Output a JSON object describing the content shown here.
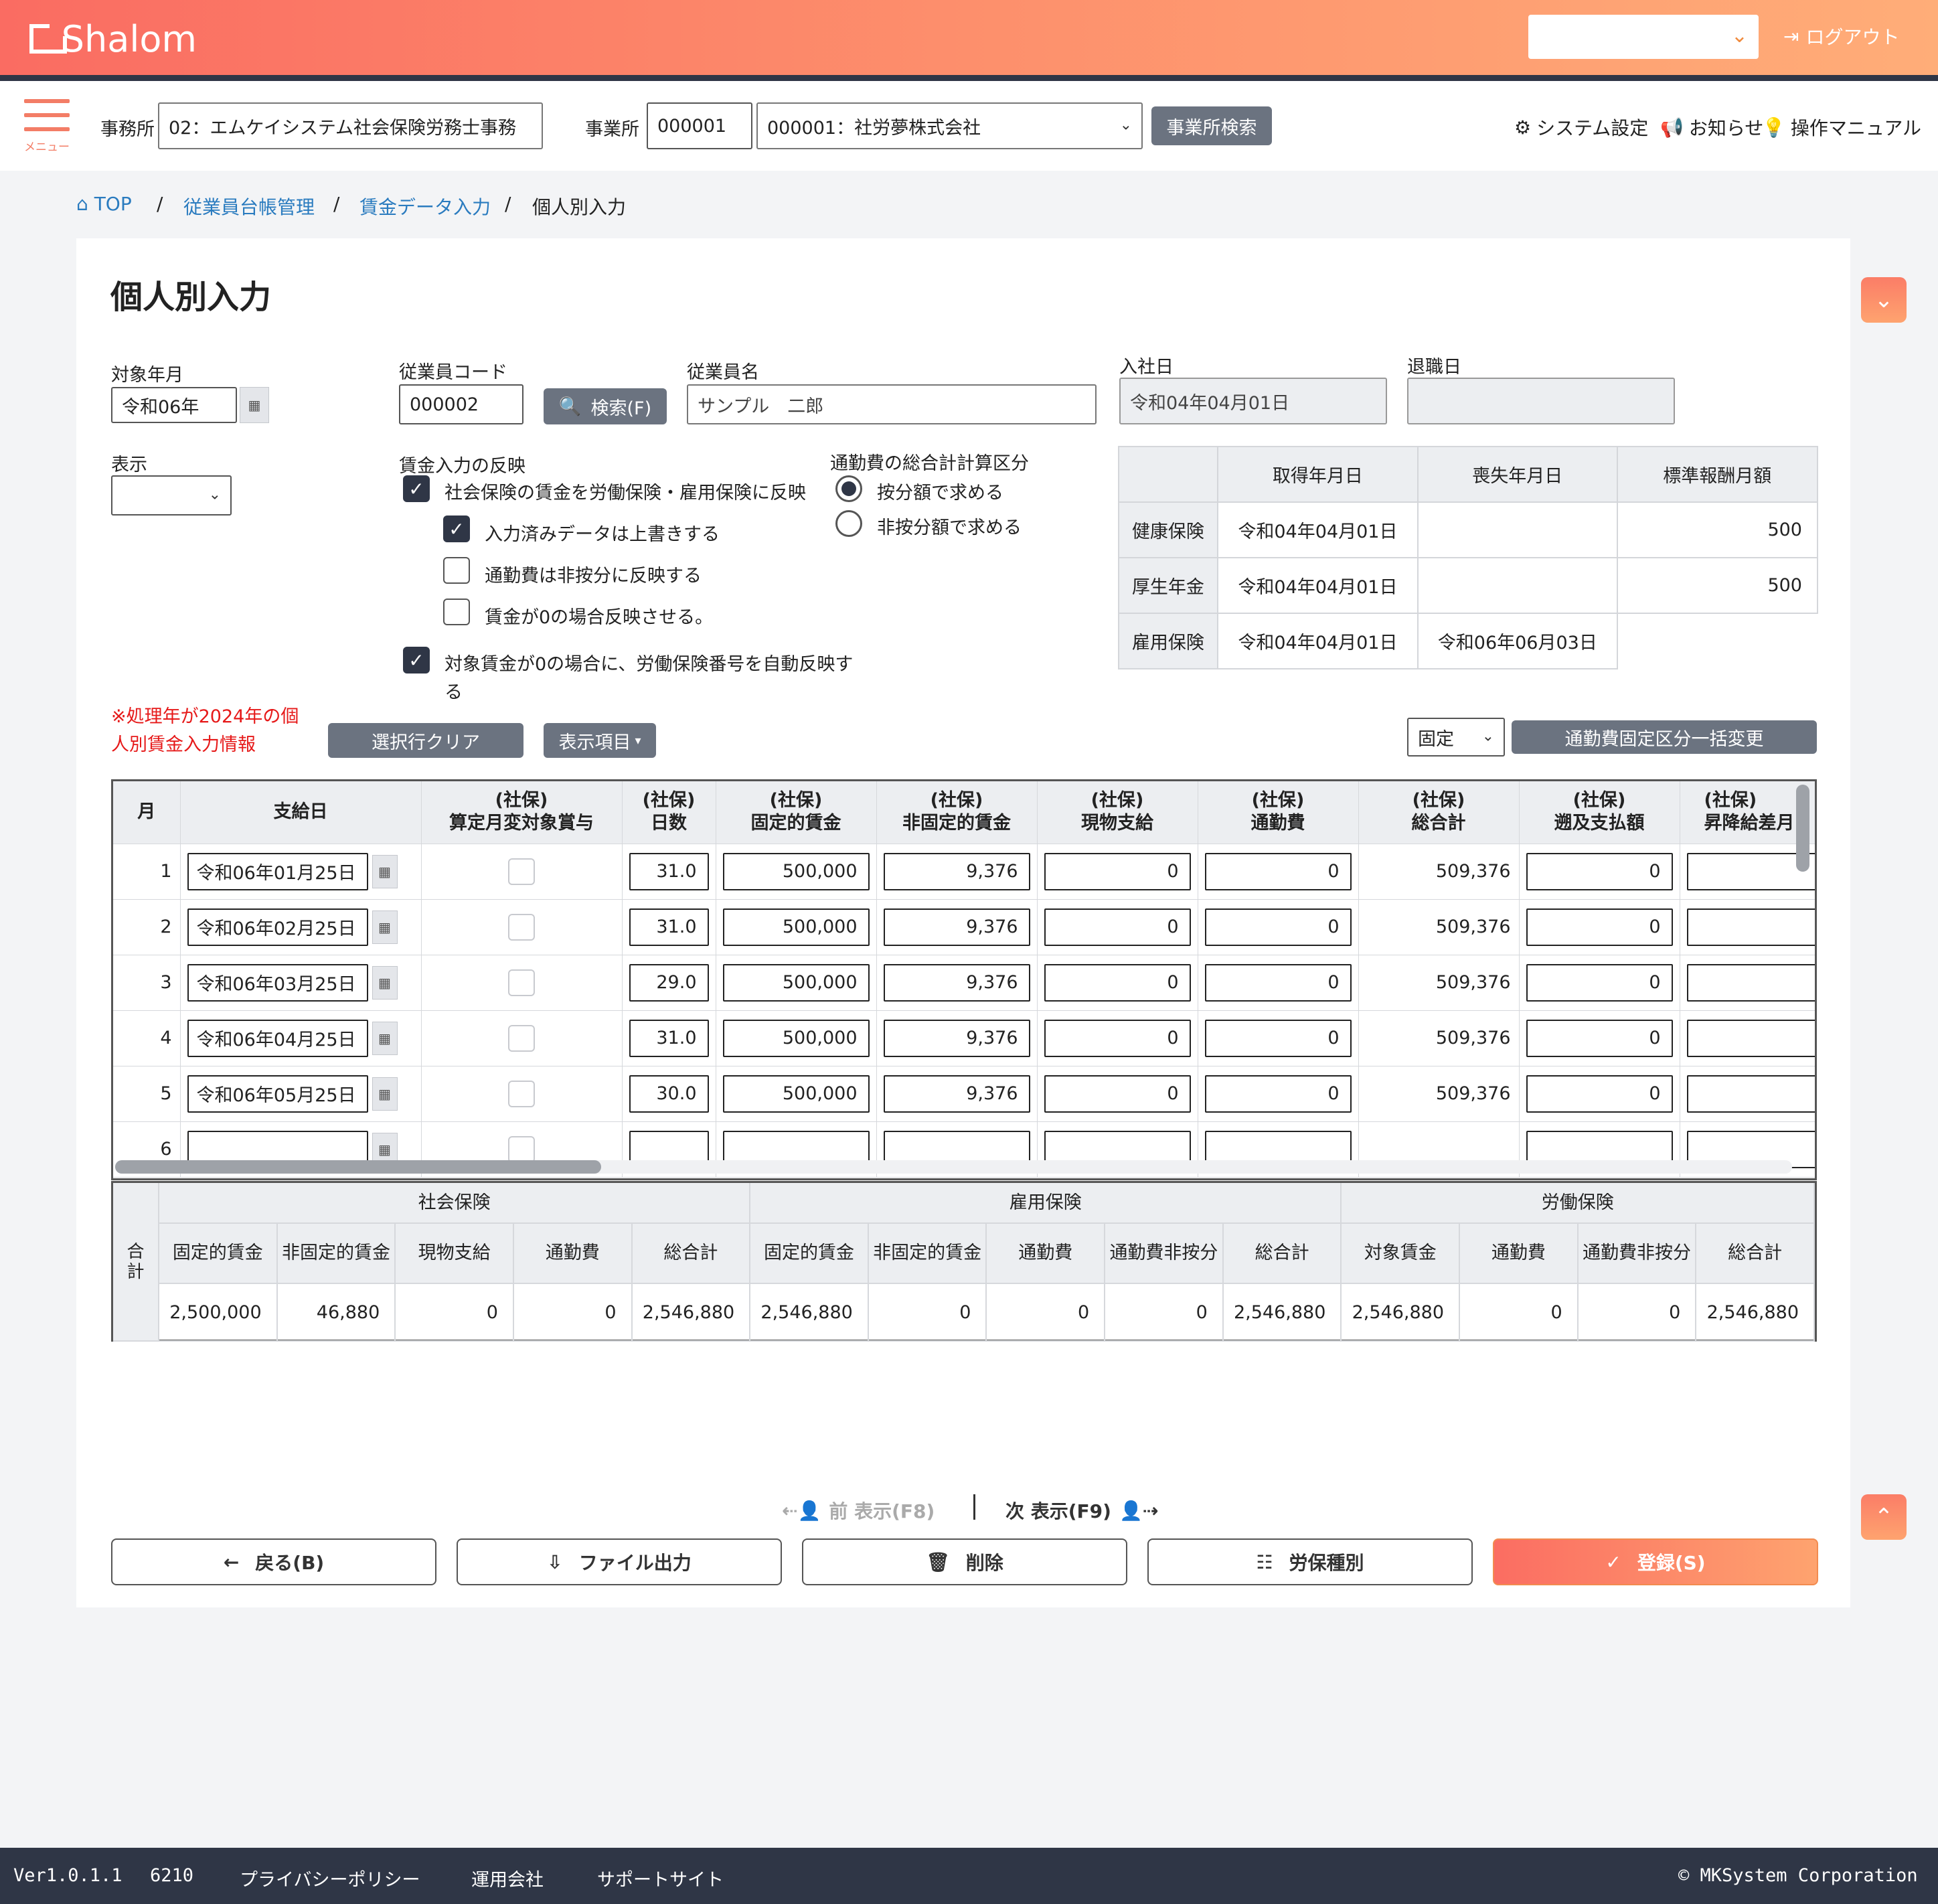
{
  "header": {
    "logo": "Shalom",
    "office_select_value": "",
    "logout_label": "ログアウト"
  },
  "topnav": {
    "menu_label": "メニュー",
    "office_label": "事務所",
    "office_value": "02：エムケイシステム社会保険労務士事務",
    "establishment_label": "事業所",
    "establishment_code": "000001",
    "establishment_name": "000001：社労夢株式会社",
    "establishment_search_label": "事業所検索",
    "system_settings_label": "システム設定",
    "notice_label": "お知らせ",
    "manual_label": "操作マニュアル"
  },
  "breadcrumb": [
    "TOP",
    "従業員台帳管理",
    "賃金データ入力",
    "個人別入力"
  ],
  "page": {
    "title": "個人別入力"
  },
  "form": {
    "target_month_label": "対象年月",
    "target_month_value": "令和06年",
    "employee_code_label": "従業員コード",
    "employee_code_value": "000002",
    "search_label": "検索(F)",
    "employee_name_label": "従業員名",
    "employee_name_value": "サンプル　二郎",
    "join_date_label": "入社日",
    "join_date_value": "令和04年04月01日",
    "leave_date_label": "退職日",
    "leave_date_value": "",
    "display_label": "表示",
    "display_value": "",
    "reflect_label": "賃金入力の反映",
    "reflect_options": [
      {
        "label": "社会保険の賃金を労働保険・雇用保険に反映",
        "checked": true
      },
      {
        "label": "入力済みデータは上書きする",
        "checked": true
      },
      {
        "label": "通勤費は非按分に反映する",
        "checked": false
      },
      {
        "label": "賃金が0の場合反映させる。",
        "checked": false
      }
    ],
    "auto_reflect_line1": "対象賃金が0の場合に、労働保険番号を自動反映す",
    "auto_reflect_line2": "る",
    "auto_reflect_checked": true,
    "commute_calc_label": "通勤費の総合計計算区分",
    "commute_calc_options": [
      {
        "label": "按分額で求める",
        "selected": true
      },
      {
        "label": "非按分額で求める",
        "selected": false
      }
    ]
  },
  "insurance_table": {
    "headers": [
      "",
      "取得年月日",
      "喪失年月日",
      "標準報酬月額"
    ],
    "rows": [
      {
        "name": "健康保険",
        "acquired": "令和04年04月01日",
        "lost": "",
        "amount": "500"
      },
      {
        "name": "厚生年金",
        "acquired": "令和04年04月01日",
        "lost": "",
        "amount": "500"
      },
      {
        "name": "雇用保険",
        "acquired": "令和04年04月01日",
        "lost": "令和06年06月03日",
        "amount": null
      }
    ]
  },
  "notice": {
    "line1": "※処理年が2024年の個",
    "line2": "人別賃金入力情報"
  },
  "toolbar": {
    "clear_label": "選択行クリア",
    "display_items_label": "表示項目",
    "fixed_select_value": "固定",
    "bulk_change_label": "通勤費固定区分一括変更"
  },
  "grid": {
    "headers": [
      {
        "l1": "月",
        "l2": ""
      },
      {
        "l1": "支給日",
        "l2": ""
      },
      {
        "l1": "(社保)",
        "l2": "算定月変対象賞与"
      },
      {
        "l1": "(社保)",
        "l2": "日数"
      },
      {
        "l1": "(社保)",
        "l2": "固定的賃金"
      },
      {
        "l1": "(社保)",
        "l2": "非固定的賃金"
      },
      {
        "l1": "(社保)",
        "l2": "現物支給"
      },
      {
        "l1": "(社保)",
        "l2": "通勤費"
      },
      {
        "l1": "(社保)",
        "l2": "総合計"
      },
      {
        "l1": "(社保)",
        "l2": "遡及支払額"
      },
      {
        "l1": "(社保)",
        "l2": "昇降給差月"
      }
    ],
    "rows": [
      {
        "month": "1",
        "date": "令和06年01月25日",
        "days": "31.0",
        "fixed": "500,000",
        "nonfixed": "9,376",
        "inkind": "0",
        "commute": "0",
        "total": "509,376",
        "retro": "0"
      },
      {
        "month": "2",
        "date": "令和06年02月25日",
        "days": "31.0",
        "fixed": "500,000",
        "nonfixed": "9,376",
        "inkind": "0",
        "commute": "0",
        "total": "509,376",
        "retro": "0"
      },
      {
        "month": "3",
        "date": "令和06年03月25日",
        "days": "29.0",
        "fixed": "500,000",
        "nonfixed": "9,376",
        "inkind": "0",
        "commute": "0",
        "total": "509,376",
        "retro": "0"
      },
      {
        "month": "4",
        "date": "令和06年04月25日",
        "days": "31.0",
        "fixed": "500,000",
        "nonfixed": "9,376",
        "inkind": "0",
        "commute": "0",
        "total": "509,376",
        "retro": "0"
      },
      {
        "month": "5",
        "date": "令和06年05月25日",
        "days": "30.0",
        "fixed": "500,000",
        "nonfixed": "9,376",
        "inkind": "0",
        "commute": "0",
        "total": "509,376",
        "retro": "0"
      },
      {
        "month": "6",
        "date": "",
        "days": "",
        "fixed": "",
        "nonfixed": "",
        "inkind": "",
        "commute": "",
        "total": "",
        "retro": ""
      }
    ]
  },
  "totals": {
    "side_label": "合計",
    "groups": [
      "社会保険",
      "雇用保険",
      "労働保険"
    ],
    "headers": [
      "固定的賃金",
      "非固定的賃金",
      "現物支給",
      "通勤費",
      "総合計",
      "固定的賃金",
      "非固定的賃金",
      "通勤費",
      "通勤費非按分",
      "総合計",
      "対象賃金",
      "通勤費",
      "通勤費非按分",
      "総合計"
    ],
    "values": [
      "2,500,000",
      "46,880",
      "0",
      "0",
      "2,546,880",
      "2,546,880",
      "0",
      "0",
      "0",
      "2,546,880",
      "2,546,880",
      "0",
      "0",
      "2,546,880"
    ]
  },
  "pager": {
    "prev_label": "前 表示(F8)",
    "next_label": "次 表示(F9)"
  },
  "actions": {
    "back_label": "戻る(B)",
    "file_label": "ファイル出力",
    "delete_label": "削除",
    "labor_label": "労保種別",
    "register_label": "登録(S)"
  },
  "footer": {
    "version": "Ver1.0.1.1",
    "code": "6210",
    "privacy": "プライバシーポリシー",
    "company": "運用会社",
    "support": "サポートサイト",
    "copyright": "© MKSystem Corporation"
  }
}
